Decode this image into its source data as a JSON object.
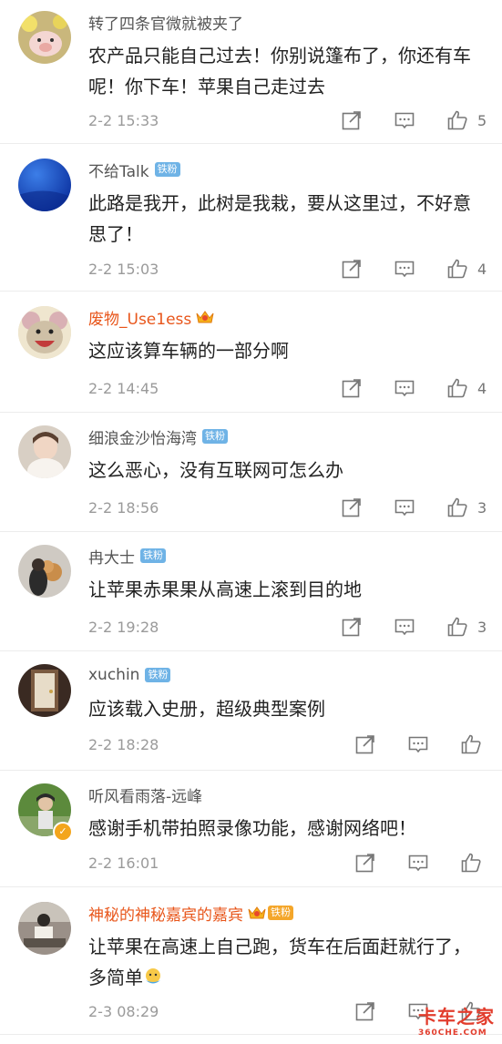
{
  "comments": [
    {
      "name": "转了四条官微就被夹了",
      "badge": "",
      "text": "农产品只能自己过去！你别说篷布了，你还有车呢！你下车！苹果自己走过去",
      "time": "2-2 15:33",
      "likes": "5"
    },
    {
      "name": "不给Talk",
      "badge": "铁粉",
      "text": "此路是我开，此树是我栽，要从这里过，不好意思了！",
      "time": "2-2 15:03",
      "likes": "4"
    },
    {
      "name": "废物_Use1ess",
      "badge": "",
      "text": "这应该算车辆的一部分啊",
      "time": "2-2 14:45",
      "likes": "4"
    },
    {
      "name": "细浪金沙怡海湾",
      "badge": "铁粉",
      "text": "这么恶心，没有互联网可怎么办",
      "time": "2-2 18:56",
      "likes": "3"
    },
    {
      "name": "冉大士",
      "badge": "铁粉",
      "text": "让苹果赤果果从高速上滚到目的地",
      "time": "2-2 19:28",
      "likes": "3"
    },
    {
      "name": "xuchin",
      "badge": "铁粉",
      "text": "应该载入史册，超级典型案例",
      "time": "2-2 18:28",
      "likes": ""
    },
    {
      "name": "听风看雨落-远峰",
      "badge": "",
      "text": "感谢手机带拍照录像功能，感谢网络吧！",
      "time": "2-2 16:01",
      "likes": ""
    },
    {
      "name": "神秘的神秘嘉宾的嘉宾",
      "badge": "铁粉",
      "text": "让苹果在高速上自己跑，货车在后面赶就行了，多简单",
      "time": "2-3 08:29",
      "likes": ""
    }
  ],
  "watermark": {
    "main": "卡车之家",
    "sub": "360CHE.COM"
  },
  "colors": {
    "vip_name": "#e8561b",
    "fan_badge": "#6fb3e6",
    "text": "#222222",
    "meta": "#9a9a9a"
  },
  "icons": [
    "share-icon",
    "comment-icon",
    "thumbs-up-icon"
  ]
}
